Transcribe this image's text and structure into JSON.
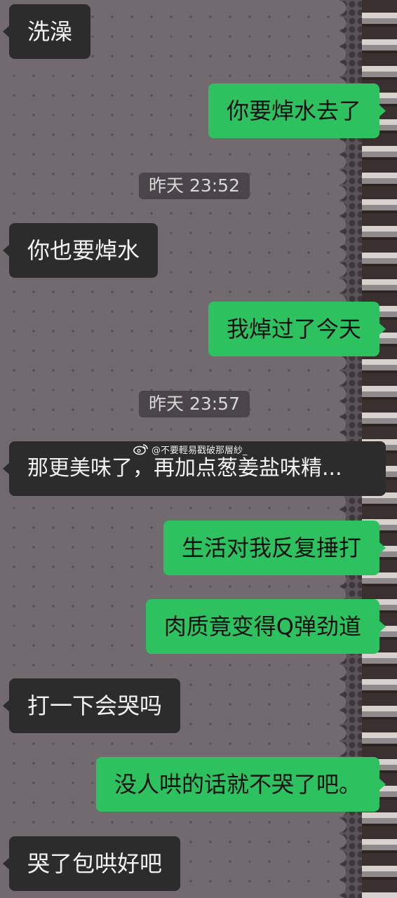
{
  "messages": [
    {
      "side": "in",
      "text": "洗澡"
    },
    {
      "side": "out",
      "text": "你要焯水去了"
    },
    {
      "side": "time",
      "text": "昨天 23:52"
    },
    {
      "side": "in",
      "text": "你也要焯水"
    },
    {
      "side": "out",
      "text": "我焯过了今天"
    },
    {
      "side": "time",
      "text": "昨天 23:57"
    },
    {
      "side": "in",
      "text": "那更美味了，再加点葱姜盐味精..."
    },
    {
      "side": "out",
      "text": "生活对我反复捶打"
    },
    {
      "side": "out",
      "text": "肉质竟变得Q弹劲道"
    },
    {
      "side": "in",
      "text": "打一下会哭吗"
    },
    {
      "side": "out",
      "text": "没人哄的话就不哭了吧。"
    },
    {
      "side": "in",
      "text": "哭了包哄好吧"
    }
  ],
  "watermark": {
    "text": "@不要輕易戳破那層紗_",
    "icon": "weibo-icon"
  },
  "colors": {
    "background": "#716a6f",
    "incoming_bubble": "#2d2c2d",
    "outgoing_bubble": "#2ec160",
    "timestamp_bg": "#4a4548"
  }
}
